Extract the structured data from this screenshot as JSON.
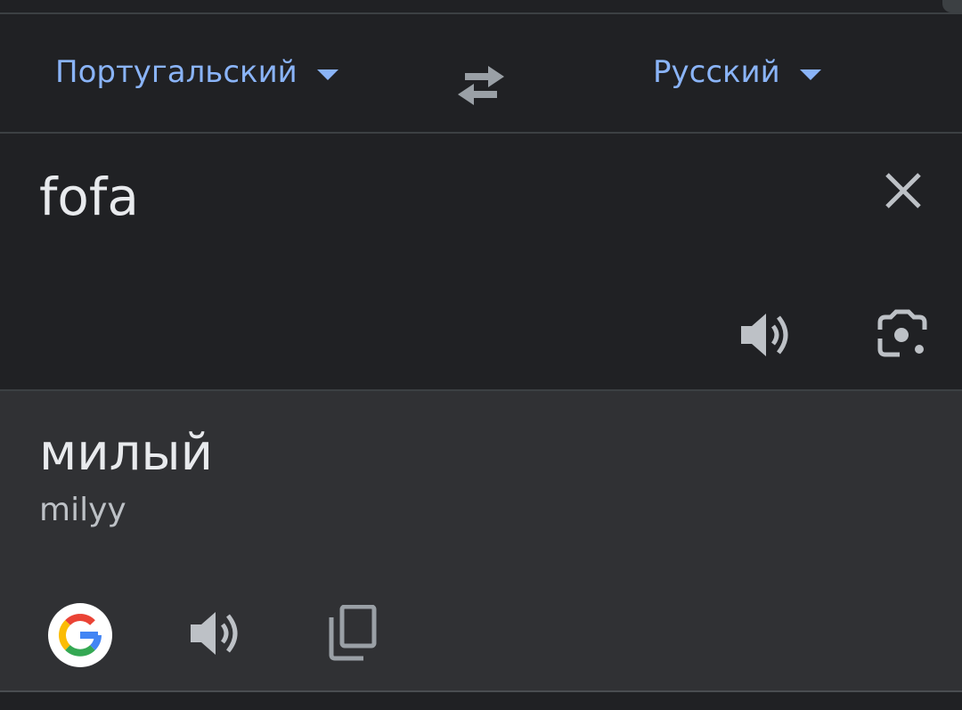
{
  "languages": {
    "source": "Португальский",
    "target": "Русский"
  },
  "input": {
    "text": "fofa"
  },
  "output": {
    "translation": "милый",
    "transliteration": "milyy"
  },
  "icons": {
    "swap": "swap-arrows-icon",
    "clear": "close-icon",
    "input_speaker": "speaker-icon",
    "lens": "camera-lens-icon",
    "google": "google-logo-icon",
    "output_speaker": "speaker-icon",
    "copy": "copy-icon"
  },
  "colors": {
    "background": "#202124",
    "output_background": "#303134",
    "accent": "#8ab4f8",
    "text": "#e8eaed",
    "secondary_text": "#bdc1c6",
    "icon": "#9aa0a6"
  }
}
